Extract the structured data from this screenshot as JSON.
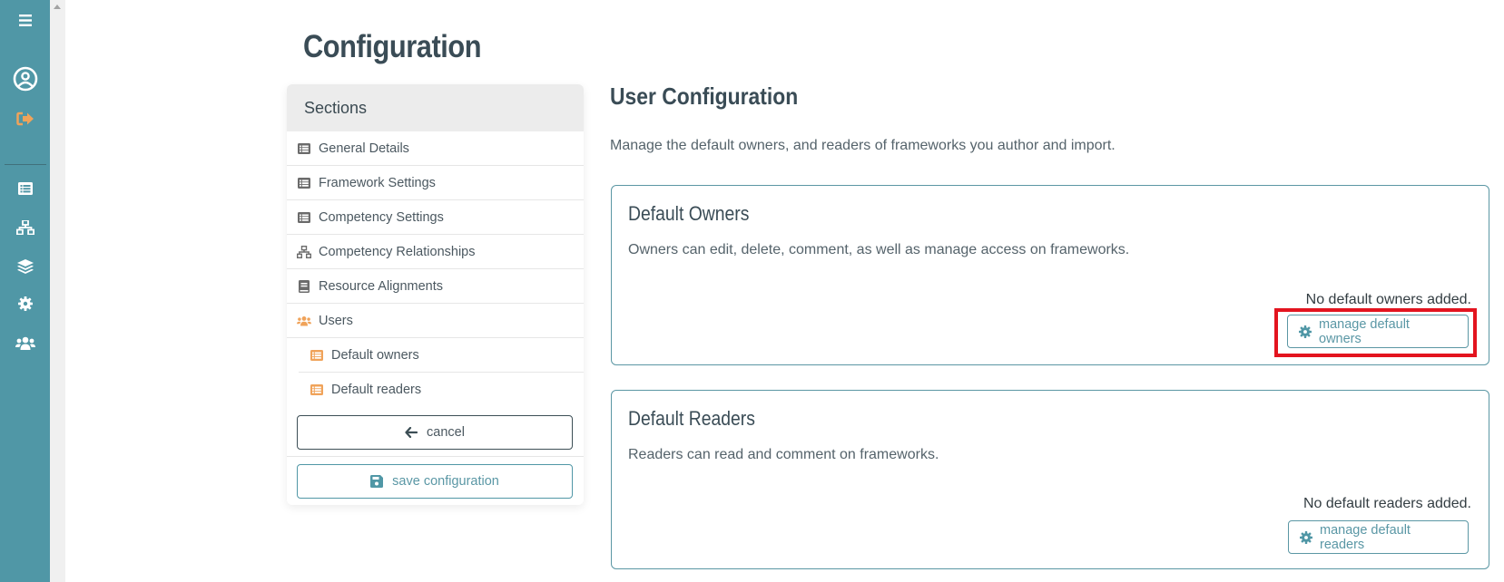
{
  "nav_rail": {
    "items": [
      {
        "icon": "hamburger-menu-icon"
      },
      {
        "icon": "user-circle-icon"
      },
      {
        "icon": "sign-out-icon"
      },
      {
        "icon": "list-icon"
      },
      {
        "icon": "sitemap-icon"
      },
      {
        "icon": "layers-icon"
      },
      {
        "icon": "gear-icon"
      },
      {
        "icon": "users-icon"
      }
    ],
    "colors": {
      "background": "#5097a6",
      "icon": "#ffffff",
      "accent": "#f0a35a"
    }
  },
  "page": {
    "title": "Configuration"
  },
  "sections_panel": {
    "header": "Sections",
    "items": [
      {
        "label": "General Details",
        "icon": "list-icon"
      },
      {
        "label": "Framework Settings",
        "icon": "list-icon"
      },
      {
        "label": "Competency Settings",
        "icon": "list-icon"
      },
      {
        "label": "Competency Relationships",
        "icon": "sitemap-icon"
      },
      {
        "label": "Resource Alignments",
        "icon": "book-icon"
      },
      {
        "label": "Users",
        "icon": "users-icon"
      }
    ],
    "sub_items": [
      {
        "label": "Default owners",
        "icon": "list-icon"
      },
      {
        "label": "Default readers",
        "icon": "list-icon"
      }
    ],
    "cancel_label": "cancel",
    "save_label": "save configuration"
  },
  "main": {
    "title": "User Configuration",
    "intro": "Manage the default owners, and readers of frameworks you author and import.",
    "cards": [
      {
        "title": "Default Owners",
        "description": "Owners can edit, delete, comment, as well as manage access on frameworks.",
        "empty_text": "No default owners added.",
        "button_label": "manage default owners",
        "highlighted": true
      },
      {
        "title": "Default Readers",
        "description": "Readers can read and comment on frameworks.",
        "empty_text": "No default readers added.",
        "button_label": "manage default readers",
        "highlighted": false
      }
    ]
  },
  "colors": {
    "primary": "#5097a6",
    "accent_orange": "#f0a35a",
    "highlight_red": "#e3141f",
    "text_dark": "#3a4c56"
  }
}
